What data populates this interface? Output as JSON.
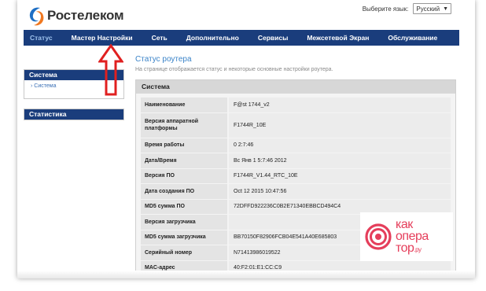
{
  "brand": {
    "name": "Ростелеком"
  },
  "language": {
    "label": "Выберите язык:",
    "selected": "Русский"
  },
  "nav": {
    "items": [
      "Статус",
      "Мастер Настройки",
      "Сеть",
      "Дополнительно",
      "Сервисы",
      "Межсетевой Экран",
      "Обслуживание"
    ],
    "active": "Статус"
  },
  "sidebar": {
    "system": {
      "title": "Система",
      "sub": "Система"
    },
    "stats": {
      "title": "Статистика"
    }
  },
  "main": {
    "title": "Статус роутера",
    "description": "На странице отображается статус и некоторые основные настройки роутера.",
    "section": "Система",
    "rows": [
      {
        "label": "Наименование",
        "value": "F@st 1744_v2"
      },
      {
        "label": "Версия аппаратной платформы",
        "value": "F1744R_10E"
      },
      {
        "label": "Время работы",
        "value": "0 2:7:46"
      },
      {
        "label": "Дата/Время",
        "value": "Вс Янв 1 5:7:46 2012"
      },
      {
        "label": "Версия ПО",
        "value": "F1744R_V1.44_RTC_10E"
      },
      {
        "label": "Дата создания ПО",
        "value": "Oct 12 2015 10:47:56"
      },
      {
        "label": "MD5 сумма ПО",
        "value": "72DFFD922236C0B2E71340EBBCD494C4"
      },
      {
        "label": "Версия загрузчика",
        "value": ""
      },
      {
        "label": "MD5 сумма загрузчика",
        "value": "BB70150F82906FCB04E541A40E685803"
      },
      {
        "label": "Серийный номер",
        "value": "N71413986019522"
      },
      {
        "label": "MAC-адрес",
        "value": "40:F2:01:E1:CC:C9"
      }
    ]
  },
  "watermark": {
    "line1": "как",
    "line2": "опера",
    "line3": "тор",
    "suffix": ".ру"
  },
  "colors": {
    "nav_bg": "#1a3d7c",
    "title_blue": "#3a83c8",
    "arrow_red": "#e02020",
    "watermark": "#e53e5b"
  }
}
